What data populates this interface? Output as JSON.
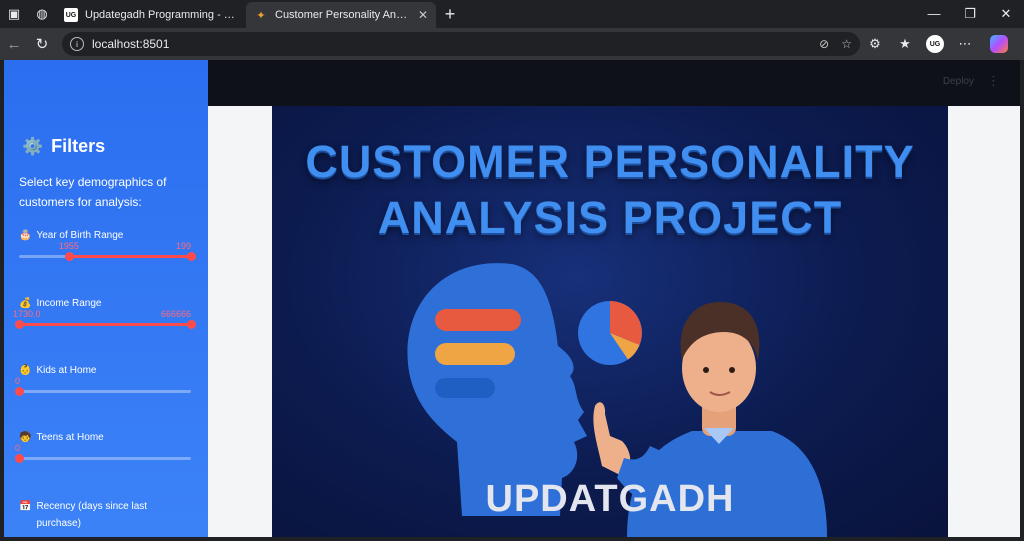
{
  "browser": {
    "tabs": [
      {
        "title": "Updategadh Programming - Upd",
        "favicon": "UG",
        "active": false
      },
      {
        "title": "Customer Personality Analysis",
        "favicon": "person-icon",
        "active": true
      }
    ],
    "new_tab_symbol": "+",
    "url": "localhost:8501",
    "profile_initials": "UG"
  },
  "app": {
    "deploy_label": "Deploy",
    "sidebar": {
      "title": "Filters",
      "description": "Select key demographics of customers for analysis:",
      "sliders": [
        {
          "emoji": "🎂",
          "label": "Year of Birth Range",
          "min_label": "1955",
          "max_label": "199",
          "low": 0.29,
          "high": 1.0
        },
        {
          "emoji": "💰",
          "label": "Income Range",
          "min_label": "1730.0",
          "max_label": "666666",
          "low": 0.0,
          "high": 1.0
        },
        {
          "emoji": "👶",
          "label": "Kids at Home",
          "min_label": "0",
          "max_label": "",
          "low": 0.0,
          "high": 0.0
        },
        {
          "emoji": "🧒",
          "label": "Teens at Home",
          "min_label": "0",
          "max_label": "",
          "low": 0.0,
          "high": 0.0
        },
        {
          "emoji": "📅",
          "label": "Recency (days since last purchase)",
          "min_label": "",
          "max_label": "",
          "low": 0.0,
          "high": 0.0
        }
      ]
    },
    "hero": {
      "title_line1": "CUSTOMER PERSONALITY",
      "title_line2": "ANALYSIS PROJECT",
      "brand": "UPDATGADH",
      "pie_slices": [
        0.75,
        0.15,
        0.1
      ]
    }
  },
  "colors": {
    "sidebar": "#3478f6",
    "accent": "#ff4b4b",
    "hero_title": "#3f8ef0"
  }
}
